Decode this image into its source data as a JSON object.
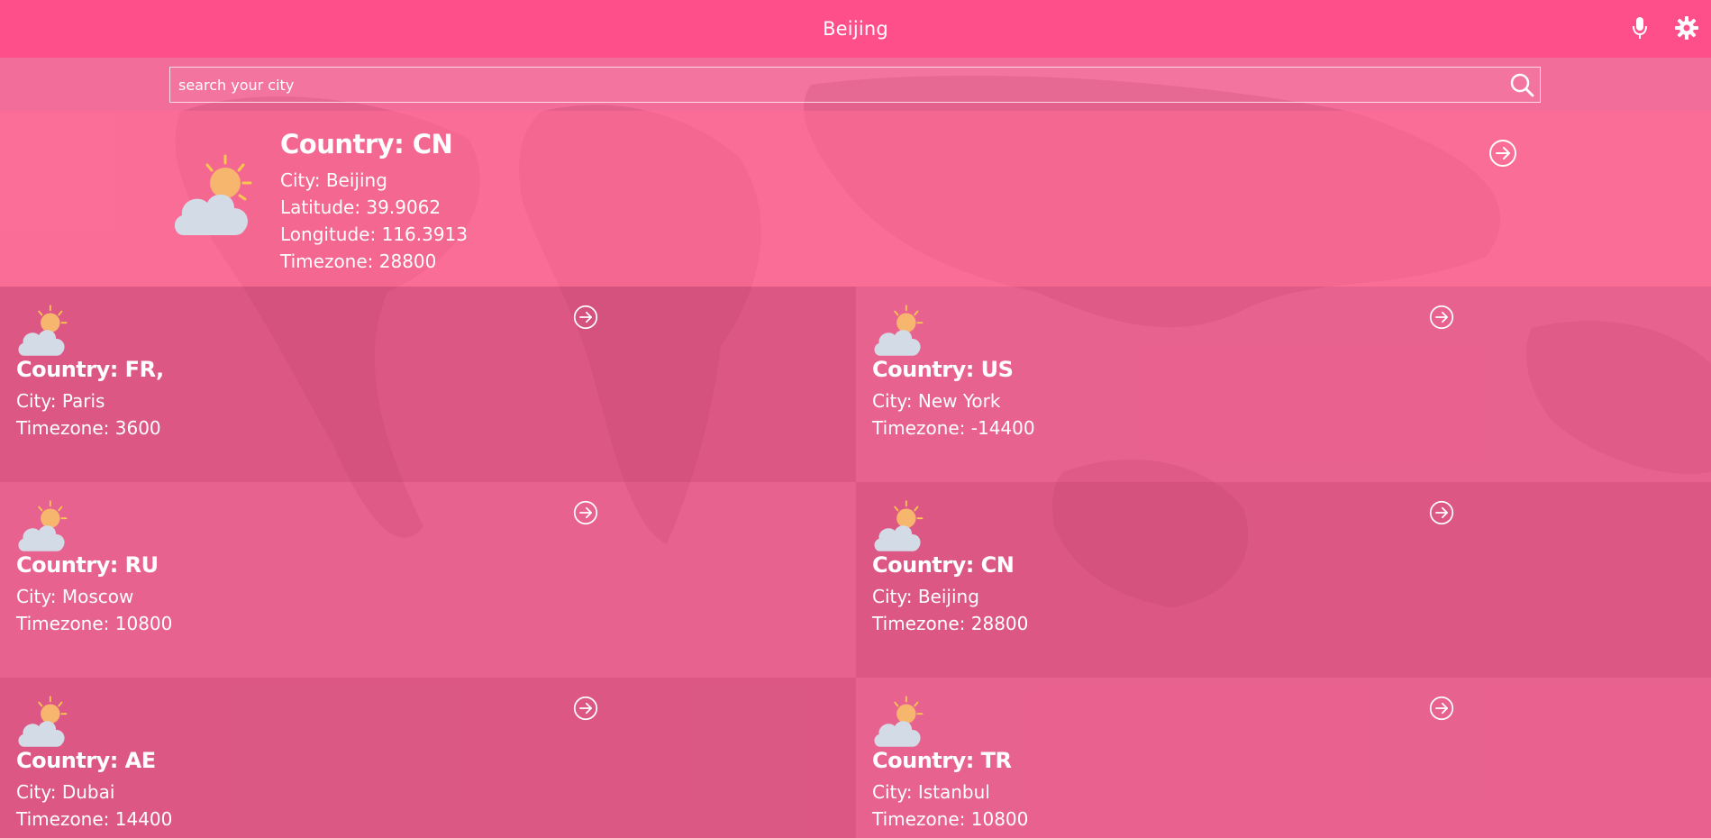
{
  "header": {
    "title": "Beijing",
    "mic_icon": "microphone-icon",
    "settings_icon": "gear-icon"
  },
  "search": {
    "placeholder": "search your city",
    "value": "",
    "icon": "search-icon"
  },
  "current": {
    "country": "Country: CN",
    "city": "City: Beijing",
    "latitude": "Latitude: 39.9062",
    "longitude": "Longitude: 116.3913",
    "timezone": "Timezone: 28800",
    "weather_icon": "partly-cloudy-icon"
  },
  "cities": [
    {
      "country": "Country: FR,",
      "city": "City: Paris",
      "timezone": "Timezone: 3600"
    },
    {
      "country": "Country: US",
      "city": "City: New York",
      "timezone": "Timezone: -14400"
    },
    {
      "country": "Country: RU",
      "city": "City: Moscow",
      "timezone": "Timezone: 10800"
    },
    {
      "country": "Country: CN",
      "city": "City: Beijing",
      "timezone": "Timezone: 28800"
    },
    {
      "country": "Country: AE",
      "city": "City: Dubai",
      "timezone": "Timezone: 14400"
    },
    {
      "country": "Country: TR",
      "city": "City: Istanbul",
      "timezone": "Timezone: 10800"
    }
  ],
  "colors": {
    "header": "#ff4f8b",
    "background": "#f36d9a",
    "tile_dark": "#d9587f",
    "tile_light": "#e5618a"
  }
}
